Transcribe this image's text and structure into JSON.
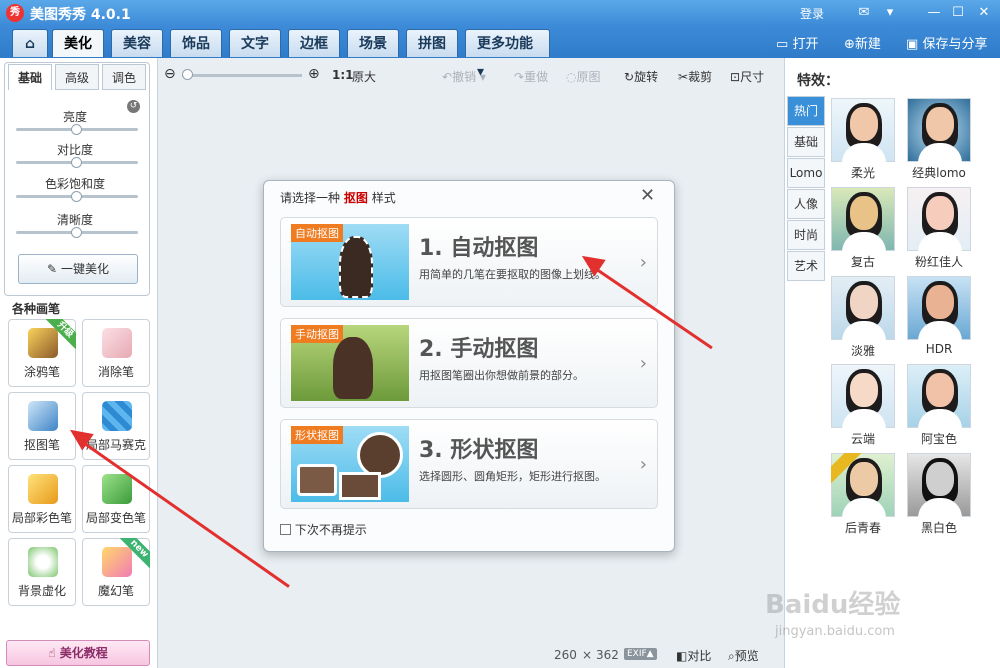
{
  "titlebar": {
    "logo": "秀",
    "title": "美图秀秀 4.0.1",
    "login": "登录"
  },
  "tabs": [
    "美化",
    "美容",
    "饰品",
    "文字",
    "边框",
    "场景",
    "拼图",
    "更多功能"
  ],
  "top_actions": {
    "open": "打开",
    "new": "新建",
    "save": "保存与分享"
  },
  "left": {
    "subtabs": [
      "基础",
      "高级",
      "调色"
    ],
    "sliders": [
      "亮度",
      "对比度",
      "色彩饱和度",
      "清晰度"
    ],
    "one_click": "一键美化",
    "brush_header": "各种画笔",
    "brushes": [
      {
        "label": "涂鸦笔",
        "badge": "升级"
      },
      {
        "label": "消除笔",
        "badge": ""
      },
      {
        "label": "抠图笔",
        "badge": ""
      },
      {
        "label": "局部马赛克",
        "badge": ""
      },
      {
        "label": "局部彩色笔",
        "badge": ""
      },
      {
        "label": "局部变色笔",
        "badge": ""
      },
      {
        "label": "背景虚化",
        "badge": ""
      },
      {
        "label": "魔幻笔",
        "badge": "new"
      }
    ],
    "tutorial": "美化教程"
  },
  "toolbar": {
    "ratio": "1:1",
    "original_size": "原大",
    "undo": "撤销",
    "redo": "重做",
    "original": "原图",
    "rotate": "旋转",
    "crop": "裁剪",
    "size": "尺寸"
  },
  "dialog": {
    "title_pre": "请选择一种",
    "title_highlight": "抠图",
    "title_post": "样式",
    "options": [
      {
        "tag": "自动抠图",
        "title": "1. 自动抠图",
        "desc": "用简单的几笔在要抠取的图像上划线。"
      },
      {
        "tag": "手动抠图",
        "title": "2. 手动抠图",
        "desc": "用抠图笔圈出你想做前景的部分。"
      },
      {
        "tag": "形状抠图",
        "title": "3. 形状抠图",
        "desc": "选择圆形、圆角矩形，矩形进行抠图。"
      }
    ],
    "dont_show": "下次不再提示"
  },
  "right": {
    "header": "特效：",
    "tabs": [
      "热门",
      "基础",
      "Lomo",
      "人像",
      "时尚",
      "艺术"
    ],
    "effects": [
      "柔光",
      "经典lomo",
      "复古",
      "粉红佳人",
      "淡雅",
      "HDR",
      "云端",
      "阿宝色",
      "后青春",
      "黑白色"
    ],
    "watermark_main": "Baidu经验",
    "watermark_sub": "jingyan.baidu.com"
  },
  "status": {
    "width": "260",
    "x": "×",
    "height": "362",
    "exif": "EXIF▲",
    "compare": "对比",
    "preview": "预览"
  },
  "colors": {
    "titlebar": "#3d8bd8",
    "accent": "#3a8fd9",
    "highlight": "#cc0000",
    "arrow": "#e2302f",
    "tag": "#f07c22"
  }
}
